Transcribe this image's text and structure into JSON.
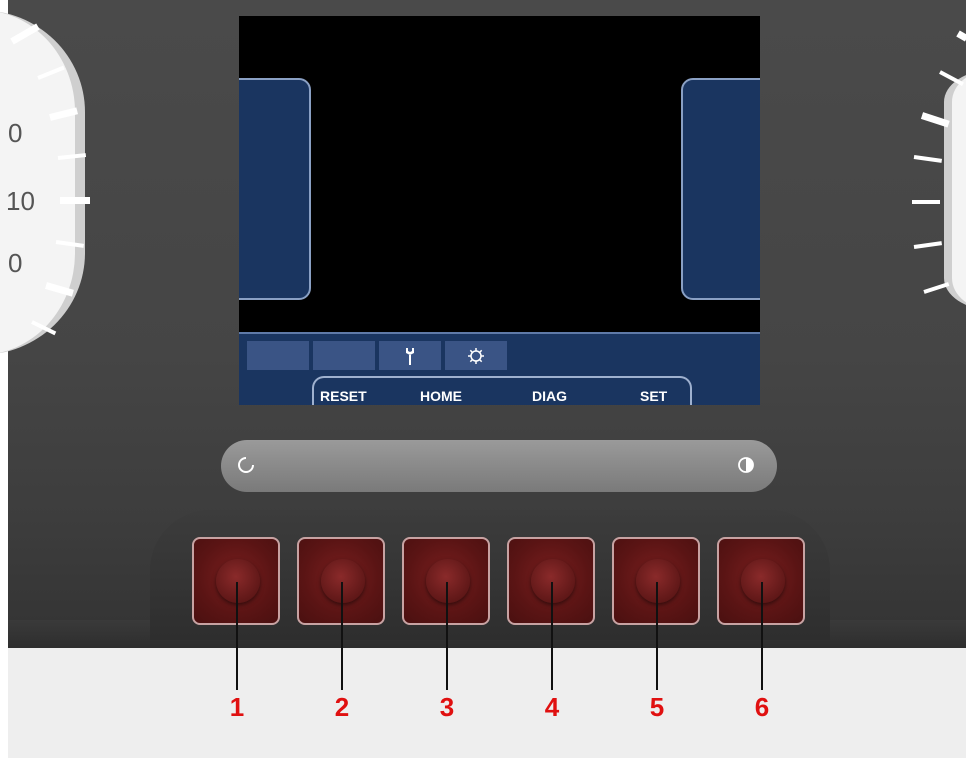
{
  "gauge_left": {
    "labels": [
      "0",
      "10",
      "0"
    ]
  },
  "display": {
    "status_icons": [
      "",
      "",
      "wrench-icon",
      "gear-icon"
    ],
    "softkeys": [
      "RESET",
      "HOME",
      "DIAG",
      "SET"
    ]
  },
  "slider": {
    "left_icon": "refresh-icon",
    "right_icon": "contrast-icon"
  },
  "buttons": [
    "1",
    "2",
    "3",
    "4",
    "5",
    "6"
  ],
  "colors": {
    "screen_panel": "#1a3560",
    "button_red": "#5a1414",
    "label_red": "#e01010"
  }
}
